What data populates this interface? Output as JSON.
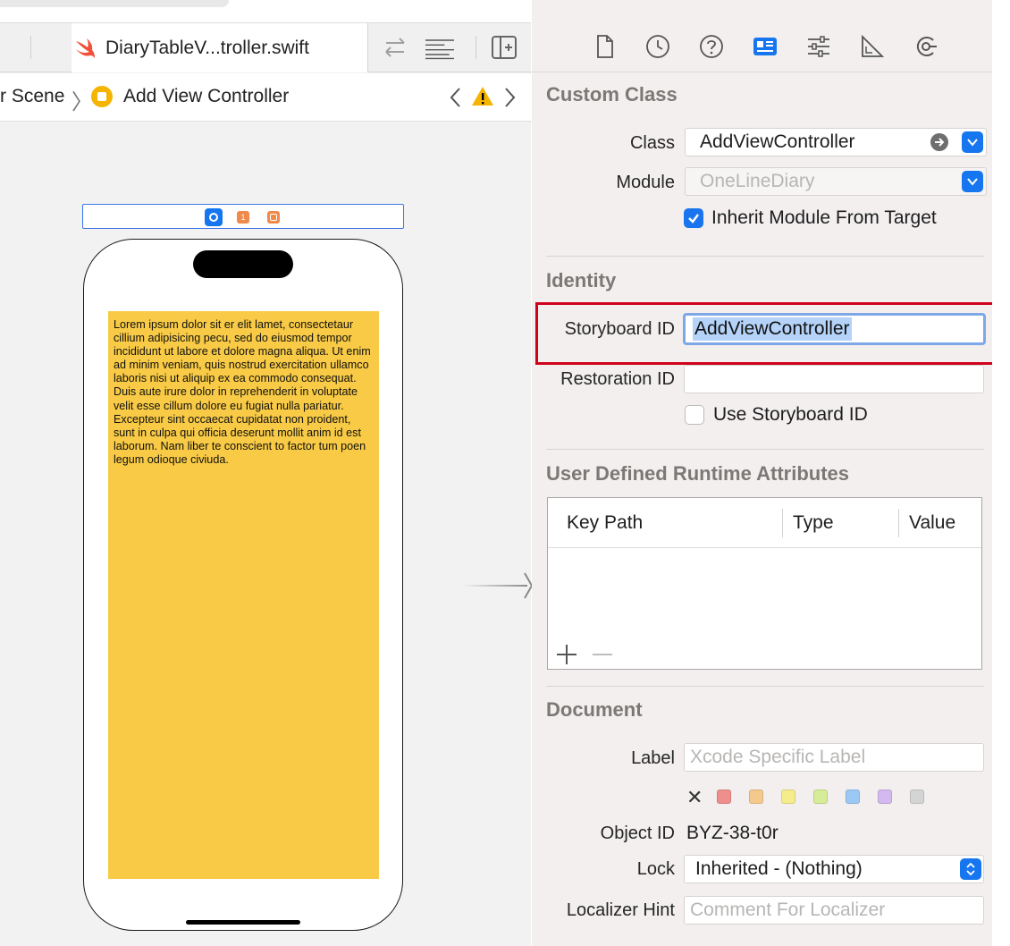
{
  "editor": {
    "tab_filename": "DiaryTableV...troller.swift",
    "breadcrumb": {
      "scene": "r Scene",
      "controller": "Add View Controller"
    },
    "lorem_text": "Lorem ipsum dolor sit er elit lamet, consectetaur cillium adipisicing pecu, sed do eiusmod tempor incididunt ut labore et dolore magna aliqua. Ut enim ad minim veniam, quis nostrud exercitation ullamco laboris nisi ut aliquip ex ea commodo consequat. Duis aute irure dolor in reprehenderit in voluptate velit esse cillum dolore eu fugiat nulla pariatur. Excepteur sint occaecat cupidatat non proident, sunt in culpa qui officia deserunt mollit anim id est laborum. Nam liber te conscient to factor tum poen legum odioque civiuda.",
    "scene_dock_badge": "1",
    "view_background": "#f8ca45"
  },
  "inspector": {
    "tabs": [
      "file-icon",
      "history-icon",
      "help-icon",
      "identity-icon",
      "attributes-icon",
      "size-icon",
      "connections-icon"
    ],
    "active_tab": "identity-icon",
    "custom_class": {
      "title": "Custom Class",
      "class_label": "Class",
      "class_value": "AddViewController",
      "module_label": "Module",
      "module_placeholder": "OneLineDiary",
      "inherit_label": "Inherit Module From Target",
      "inherit_checked": true
    },
    "identity": {
      "title": "Identity",
      "storyboard_id_label": "Storyboard ID",
      "storyboard_id_value": "AddViewController",
      "restoration_id_label": "Restoration ID",
      "restoration_id_value": "",
      "use_storyboard_id_label": "Use Storyboard ID",
      "use_storyboard_id_checked": false
    },
    "runtime_attributes": {
      "title": "User Defined Runtime Attributes",
      "columns": [
        "Key Path",
        "Type",
        "Value"
      ],
      "add_label": "+",
      "remove_label": "—"
    },
    "document": {
      "title": "Document",
      "label_label": "Label",
      "label_placeholder": "Xcode Specific Label",
      "clear_label": "✕",
      "label_colors": [
        "#ef8f8c",
        "#f5c98c",
        "#f5ec8c",
        "#d6ec98",
        "#9cc8f5",
        "#d4b8f0",
        "#d4d4d4"
      ],
      "object_id_label": "Object ID",
      "object_id_value": "BYZ-38-t0r",
      "lock_label": "Lock",
      "lock_value": "Inherited - (Nothing)",
      "localizer_label": "Localizer Hint",
      "localizer_placeholder": "Comment For Localizer"
    }
  },
  "colors": {
    "accent": "#1676ef",
    "highlight": "#d0021b",
    "warning": "#f5b400"
  }
}
